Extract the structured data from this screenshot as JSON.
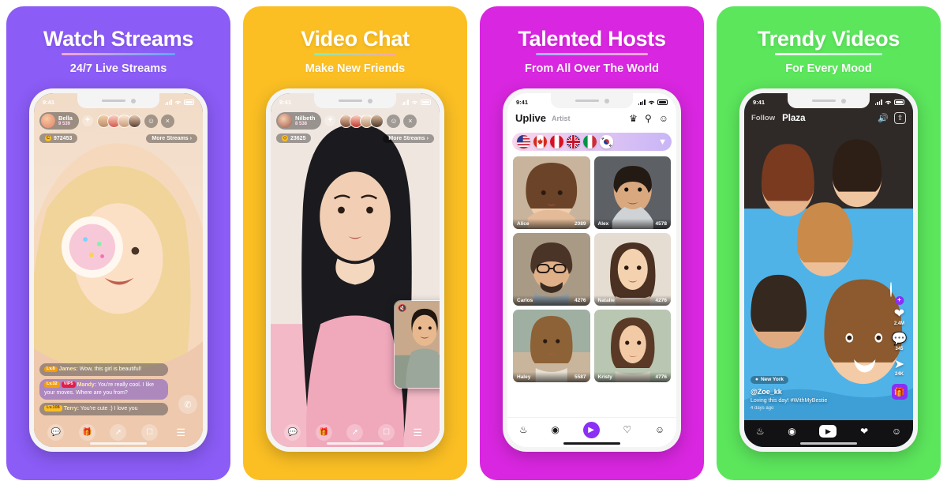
{
  "panels": [
    {
      "bg_color": "#8b5cf6",
      "title": "Watch Streams",
      "subtitle": "24/7 Live Streams",
      "status_time": "9:41",
      "host_name": "Bella",
      "host_followers": "9 539",
      "plus_label": "+",
      "coins": "972453",
      "coin_icon": "C",
      "more_streams": "More Streams",
      "more_chevron": "›",
      "add_friend_icon": "person-add-icon",
      "close_icon": "×",
      "messages": [
        {
          "badges": [
            "Lv.8"
          ],
          "user": "James:",
          "text": "Wow, this girl is beautiful!",
          "style": "grey"
        },
        {
          "badges": [
            "Lv.32",
            "VIP5"
          ],
          "user": "Mandy:",
          "text": "You're really cool. I like your moves. Where are you from?",
          "style": "vip"
        },
        {
          "badges": [
            "Lv.108"
          ],
          "user": "Terry:",
          "text": "You're cute :)  I love you",
          "style": "grey"
        }
      ],
      "call_icon": "video-call-icon",
      "toolbar": [
        "chat-icon",
        "gift-icon",
        "share-icon",
        "gallery-icon",
        "menu-icon"
      ]
    },
    {
      "bg_color": "#fbbf24",
      "title": "Video Chat",
      "subtitle": "Make New Friends",
      "status_time": "9:41",
      "host_name": "Nilbeth",
      "host_followers": "8 538",
      "plus_label": "+",
      "coins": "23625",
      "coin_icon": "◇",
      "more_streams": "More Streams",
      "more_chevron": "›",
      "add_friend_icon": "person-add-icon",
      "close_icon": "×",
      "pip_mute_icon": "mic-muted-icon",
      "toolbar": [
        "chat-icon",
        "gift-icon",
        "share-icon",
        "gallery-icon",
        "menu-icon"
      ]
    },
    {
      "bg_color": "#d926e0",
      "title": "Talented Hosts",
      "subtitle": "From All Over The World",
      "status_time": "9:41",
      "app_name": "Uplive",
      "tab_label": "Artist",
      "header_icons": [
        "trophy-icon",
        "search-icon",
        "emoji-icon"
      ],
      "filter_icon": "filter-icon",
      "flags": [
        "United States",
        "Canada",
        "Peru",
        "United Kingdom",
        "Italy",
        "South Korea"
      ],
      "hosts": [
        {
          "name": "Alice",
          "value": "2089"
        },
        {
          "name": "Alex",
          "value": "4578"
        },
        {
          "name": "Carlos",
          "value": "4276"
        },
        {
          "name": "Natalie",
          "value": "4276"
        },
        {
          "name": "Haley",
          "value": "5587"
        },
        {
          "name": "Kristy",
          "value": "4776"
        }
      ],
      "tabbar": [
        "flame-icon",
        "globe-icon",
        "video-icon",
        "heart-icon",
        "profile-icon"
      ]
    },
    {
      "bg_color": "#5ce65c",
      "title": "Trendy Videos",
      "subtitle": "For Every Mood",
      "status_time": "9:41",
      "tab_follow": "Follow",
      "tab_plaza": "Plaza",
      "volume_icon": "volume-icon",
      "upload_icon": "upload-icon",
      "location": "New York",
      "username": "@Zoe_kk",
      "caption": "Loving this day! #WithMyBestie",
      "timestamp": "4 days ago",
      "rail": [
        {
          "icon": "follow-avatar",
          "count": ""
        },
        {
          "icon": "heart-icon",
          "count": "2.4M"
        },
        {
          "icon": "comment-icon",
          "count": "345"
        },
        {
          "icon": "share-icon",
          "count": "24K"
        },
        {
          "icon": "gift-icon",
          "count": ""
        }
      ],
      "tabbar": [
        "flame-icon",
        "globe-icon",
        "video-icon",
        "heart-icon",
        "profile-icon"
      ]
    }
  ]
}
